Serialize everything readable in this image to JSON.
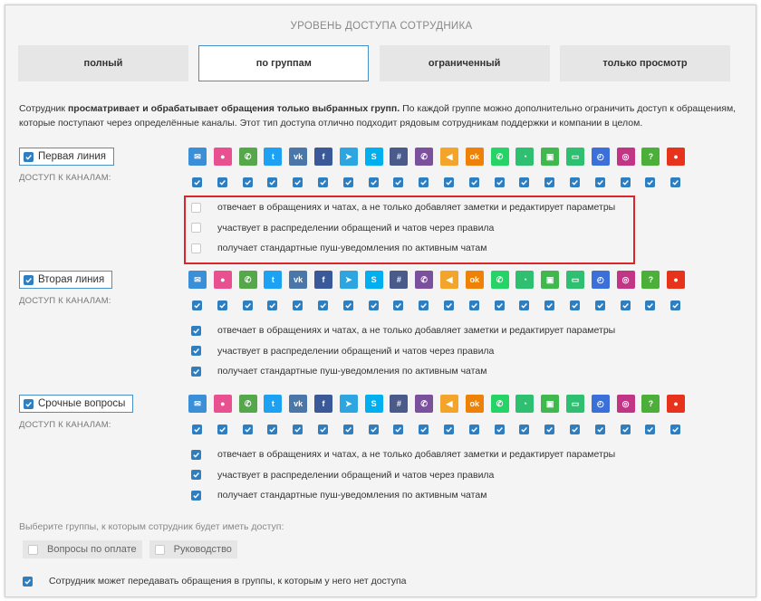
{
  "header": {
    "title": "УРОВЕНЬ ДОСТУПА СОТРУДНИКА"
  },
  "tabs": [
    {
      "label": "полный",
      "active": false
    },
    {
      "label": "по группам",
      "active": true
    },
    {
      "label": "ограниченный",
      "active": false
    },
    {
      "label": "только просмотр",
      "active": false
    }
  ],
  "description": {
    "pre": "Сотрудник ",
    "bold": "просматривает и обрабатывает обращения только выбранных групп.",
    "post": " По каждой группе можно дополнительно ограничить доступ к обращениям, которые поступают через определённые каналы. Этот тип доступа отлично подходит рядовым сотрудникам поддержки и компании в целом."
  },
  "channel_label": "ДОСТУП К КАНАЛАМ:",
  "channels": [
    {
      "icon": "email-icon",
      "color": "#3b8fd9",
      "glyph": "✉"
    },
    {
      "icon": "chat-icon",
      "color": "#e8508f",
      "glyph": "●"
    },
    {
      "icon": "phone-icon",
      "color": "#55a84a",
      "glyph": "✆"
    },
    {
      "icon": "twitter-icon",
      "color": "#1da1f2",
      "glyph": "t"
    },
    {
      "icon": "vk-icon",
      "color": "#4a76a8",
      "glyph": "vk"
    },
    {
      "icon": "facebook-icon",
      "color": "#3b5998",
      "glyph": "f"
    },
    {
      "icon": "telegram-icon",
      "color": "#2ca5e0",
      "glyph": "➤"
    },
    {
      "icon": "skype-icon",
      "color": "#00aff0",
      "glyph": "S"
    },
    {
      "icon": "slack-icon",
      "color": "#4a5a8a",
      "glyph": "#"
    },
    {
      "icon": "viber-icon",
      "color": "#7b519d",
      "glyph": "✆"
    },
    {
      "icon": "megaphone-icon",
      "color": "#f3a52b",
      "glyph": "◀"
    },
    {
      "icon": "odnoklassniki-icon",
      "color": "#ee8208",
      "glyph": "ok"
    },
    {
      "icon": "whatsapp-icon",
      "color": "#25d366",
      "glyph": "✆"
    },
    {
      "icon": "widget-icon",
      "color": "#2fbf71",
      "glyph": "◔"
    },
    {
      "icon": "cart-icon",
      "color": "#3fb94d",
      "glyph": "▣"
    },
    {
      "icon": "form-icon",
      "color": "#2fbf71",
      "glyph": "▭"
    },
    {
      "icon": "dashboard-icon",
      "color": "#3b6fd9",
      "glyph": "◴"
    },
    {
      "icon": "instagram-icon",
      "color": "#c13584",
      "glyph": "◎"
    },
    {
      "icon": "help-icon",
      "color": "#4caf3a",
      "glyph": "?"
    },
    {
      "icon": "speech-bubble-icon",
      "color": "#e8331c",
      "glyph": "●"
    }
  ],
  "groups": [
    {
      "name": "Первая линия",
      "checked": true,
      "options": [
        {
          "label": "отвечает в обращениях и чатах, а не только добавляет заметки и редактирует параметры",
          "checked": false
        },
        {
          "label": "участвует в распределении обращений и чатов через правила",
          "checked": false
        },
        {
          "label": "получает стандартные пуш-уведомления по активным чатам",
          "checked": false
        }
      ]
    },
    {
      "name": "Вторая линия",
      "checked": true,
      "options": [
        {
          "label": "отвечает в обращениях и чатах, а не только добавляет заметки и редактирует параметры",
          "checked": true
        },
        {
          "label": "участвует в распределении обращений и чатов через правила",
          "checked": true
        },
        {
          "label": "получает стандартные пуш-уведомления по активным чатам",
          "checked": true
        }
      ]
    },
    {
      "name": "Срочные вопросы",
      "checked": true,
      "options": [
        {
          "label": "отвечает в обращениях и чатах, а не только добавляет заметки и редактирует параметры",
          "checked": true
        },
        {
          "label": "участвует в распределении обращений и чатов через правила",
          "checked": true
        },
        {
          "label": "получает стандартные пуш-уведомления по активным чатам",
          "checked": true
        }
      ]
    }
  ],
  "choose_label": "Выберите группы, к которым сотрудник будет иметь доступ:",
  "extra_groups": [
    {
      "name": "Вопросы по оплате",
      "checked": false
    },
    {
      "name": "Руководство",
      "checked": false
    }
  ],
  "footer_option": {
    "label": "Сотрудник может передавать обращения в группы, к которым у него нет доступа",
    "checked": true
  },
  "colors": {
    "accent": "#2d7fc1",
    "highlight": "#d9262b"
  }
}
